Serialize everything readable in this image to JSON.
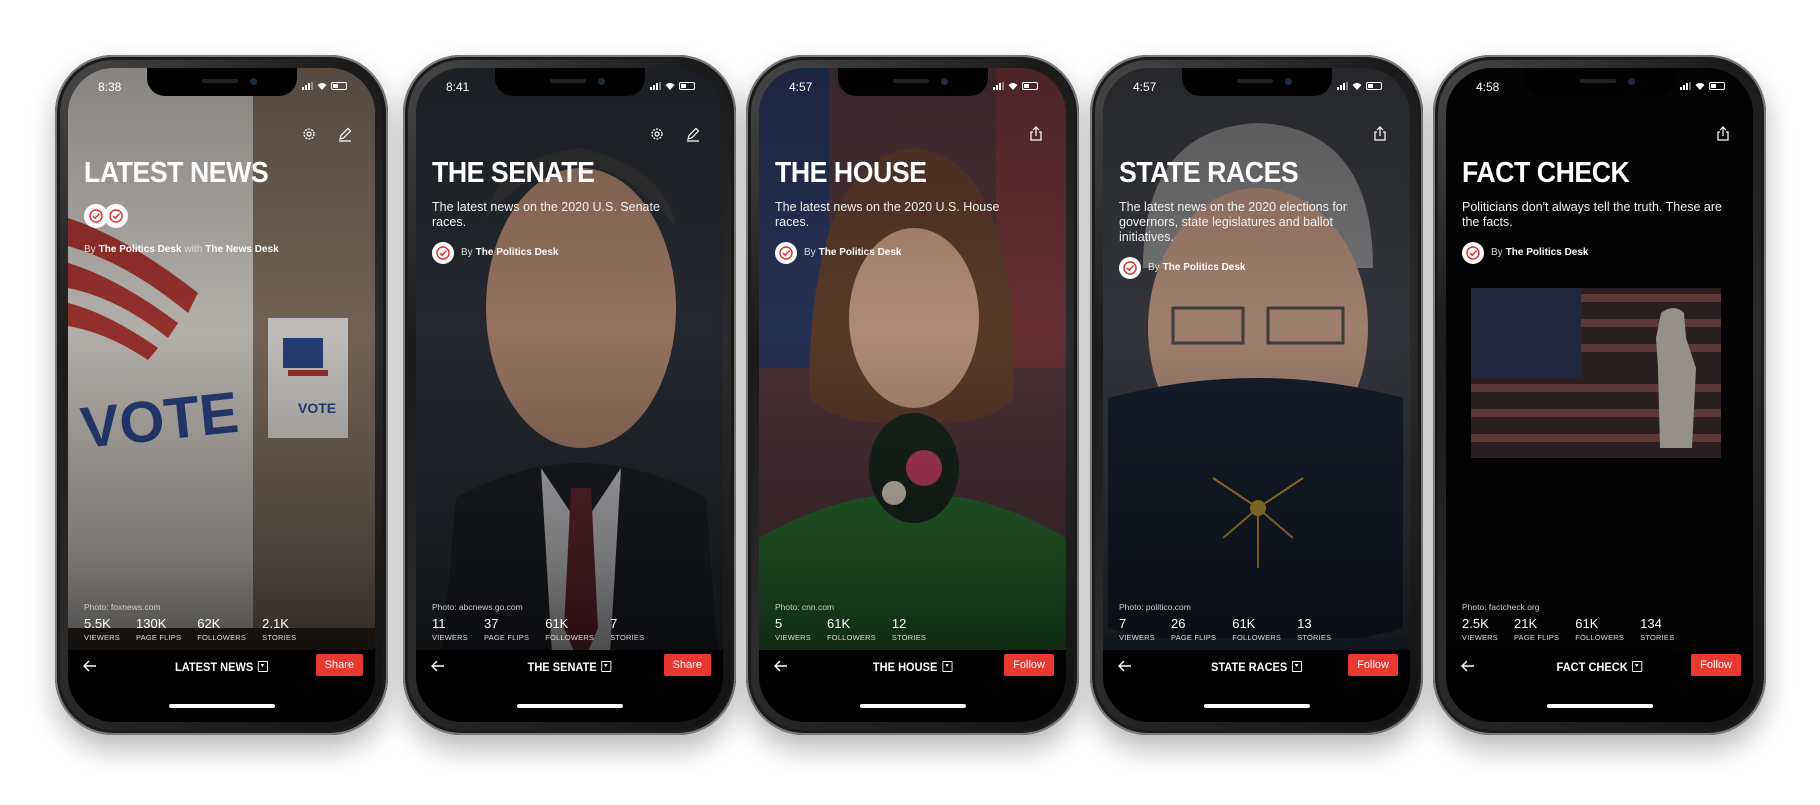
{
  "phones": [
    {
      "time": "8:38",
      "title": "LATEST NEWS",
      "description": "",
      "author_prefix": "By",
      "author": "The Politics Desk",
      "author_join": "with",
      "author2": "The News Desk",
      "photo_credit": "Photo: foxnews.com",
      "stats": [
        {
          "value": "5.5K",
          "label": "VIEWERS"
        },
        {
          "value": "130K",
          "label": "PAGE FLIPS"
        },
        {
          "value": "62K",
          "label": "FOLLOWERS"
        },
        {
          "value": "2.1K",
          "label": "STORIES"
        }
      ],
      "bar_title": "LATEST NEWS",
      "action": "Share"
    },
    {
      "time": "8:41",
      "title": "THE SENATE",
      "description": "The latest news on the 2020 U.S. Senate races.",
      "author_prefix": "By",
      "author": "The Politics Desk",
      "photo_credit": "Photo: abcnews.go.com",
      "stats": [
        {
          "value": "11",
          "label": "VIEWERS"
        },
        {
          "value": "37",
          "label": "PAGE FLIPS"
        },
        {
          "value": "61K",
          "label": "FOLLOWERS"
        },
        {
          "value": "7",
          "label": "STORIES"
        }
      ],
      "bar_title": "THE SENATE",
      "action": "Share"
    },
    {
      "time": "4:57",
      "title": "THE HOUSE",
      "description": "The latest news on the 2020 U.S. House races.",
      "author_prefix": "By",
      "author": "The Politics Desk",
      "photo_credit": "Photo: cnn.com",
      "stats": [
        {
          "value": "5",
          "label": "VIEWERS"
        },
        {
          "value": "61K",
          "label": "FOLLOWERS"
        },
        {
          "value": "12",
          "label": "STORIES"
        }
      ],
      "bar_title": "THE HOUSE",
      "action": "Follow"
    },
    {
      "time": "4:57",
      "title": "STATE RACES",
      "description": "The latest news on the 2020 elections for governors, state legislatures and ballot initiatives.",
      "author_prefix": "By",
      "author": "The Politics Desk",
      "photo_credit": "Photo: politico.com",
      "stats": [
        {
          "value": "7",
          "label": "VIEWERS"
        },
        {
          "value": "26",
          "label": "PAGE FLIPS"
        },
        {
          "value": "61K",
          "label": "FOLLOWERS"
        },
        {
          "value": "13",
          "label": "STORIES"
        }
      ],
      "bar_title": "STATE RACES",
      "action": "Follow"
    },
    {
      "time": "4:58",
      "title": "FACT CHECK",
      "description": "Politicians don't always tell the truth. These are the facts.",
      "author_prefix": "By",
      "author": "The Politics Desk",
      "photo_credit": "Photo: factcheck.org",
      "stats": [
        {
          "value": "2.5K",
          "label": "VIEWERS"
        },
        {
          "value": "21K",
          "label": "PAGE FLIPS"
        },
        {
          "value": "61K",
          "label": "FOLLOWERS"
        },
        {
          "value": "134",
          "label": "STORIES"
        }
      ],
      "bar_title": "FACT CHECK",
      "action": "Follow"
    }
  ],
  "colors": {
    "accent": "#e8382f",
    "background": "#000000",
    "text": "#ffffff"
  }
}
